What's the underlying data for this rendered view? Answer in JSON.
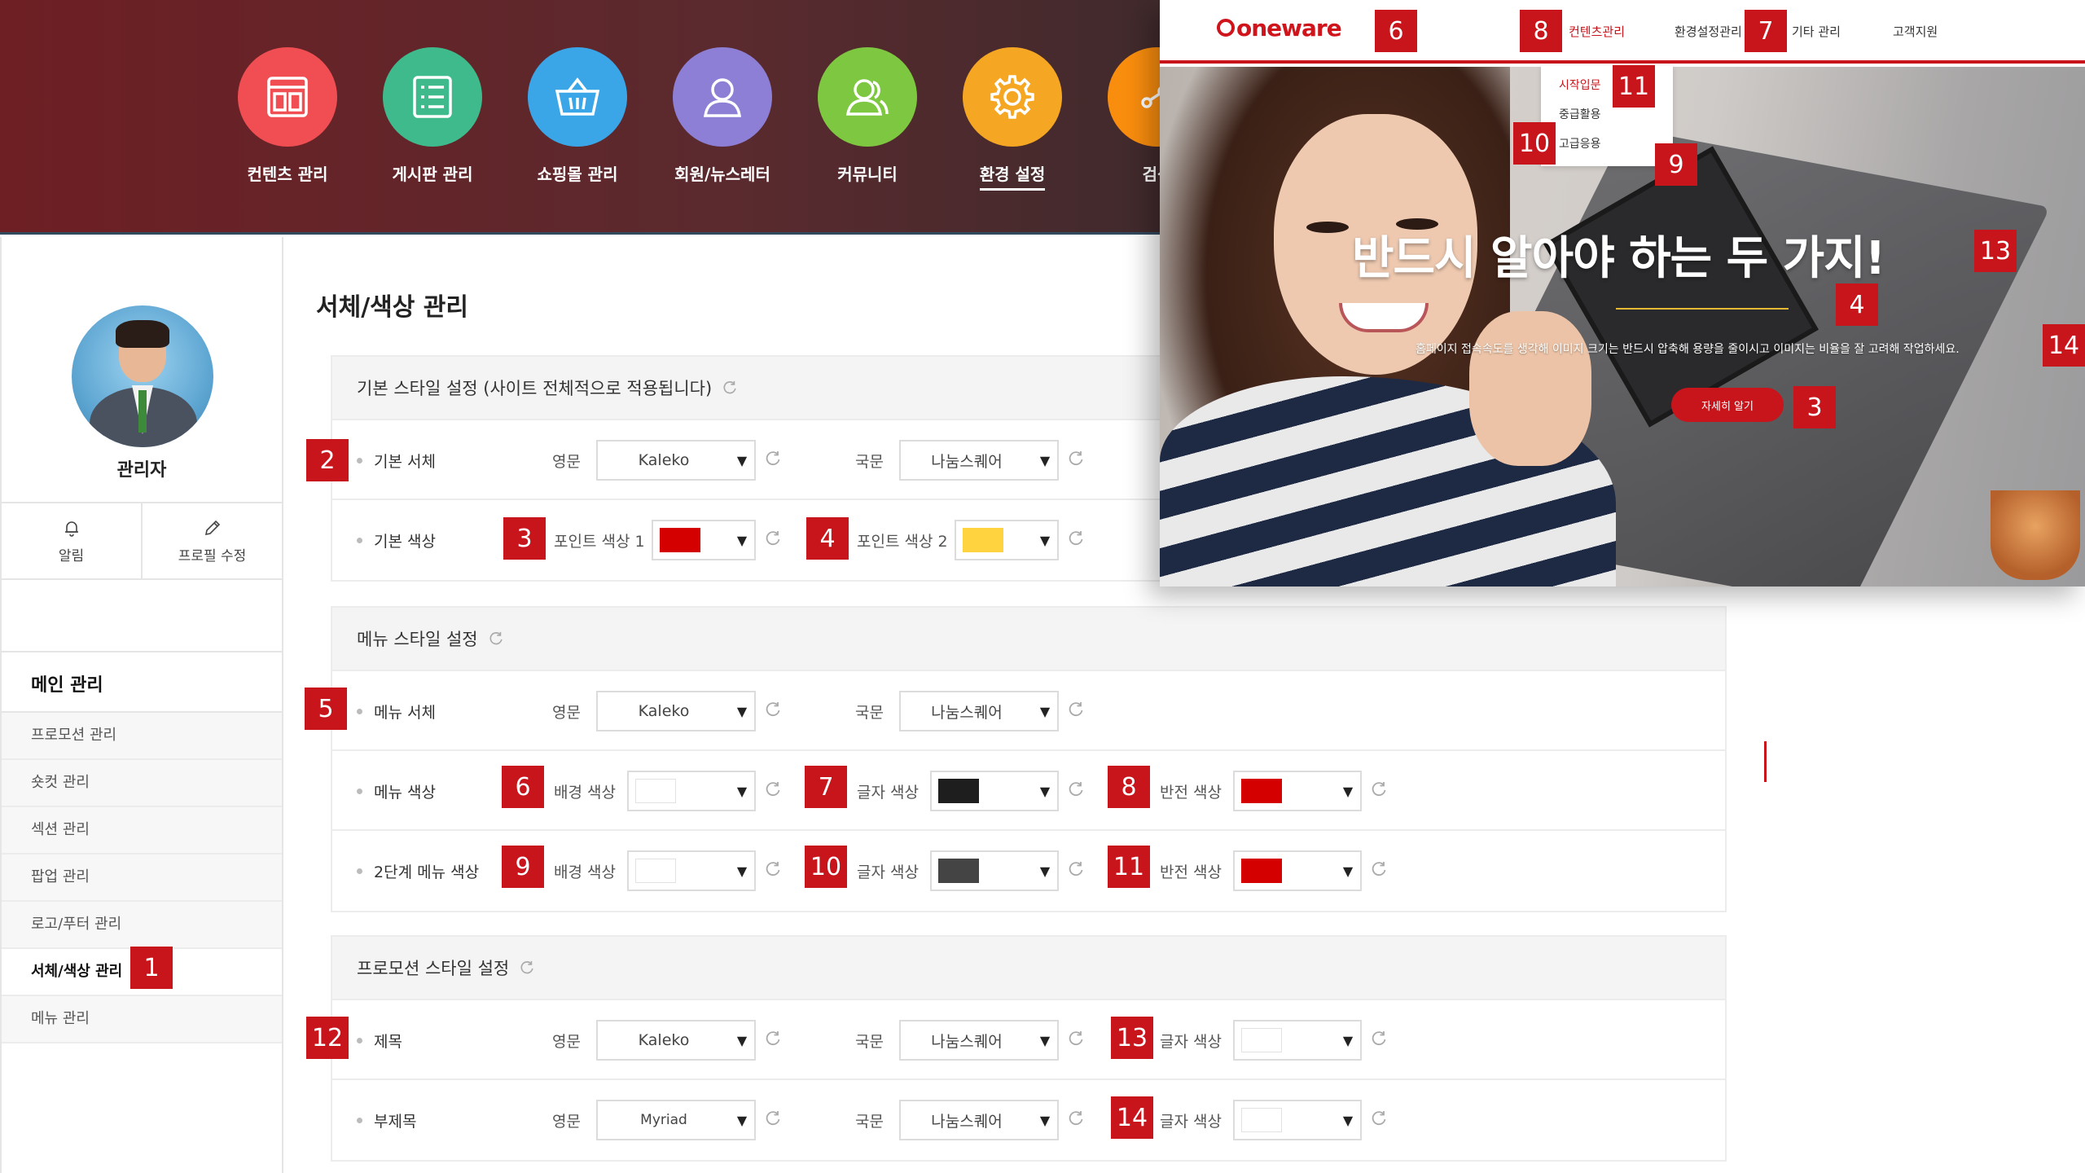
{
  "topnav": {
    "items": [
      {
        "label": "컨텐츠 관리",
        "color": "#f04e52",
        "icon": "content-icon"
      },
      {
        "label": "게시판 관리",
        "color": "#3fba8c",
        "icon": "board-icon"
      },
      {
        "label": "쇼핑몰 관리",
        "color": "#3aa6e8",
        "icon": "basket-icon"
      },
      {
        "label": "회원/뉴스레터",
        "color": "#8d7fd6",
        "icon": "user-icon"
      },
      {
        "label": "커뮤니티",
        "color": "#7ec740",
        "icon": "users-icon"
      },
      {
        "label": "환경 설정",
        "color": "#f5a623",
        "icon": "gear-icon",
        "active": true
      },
      {
        "label": "검색",
        "color": "#f98d0e",
        "icon": "share-icon"
      }
    ]
  },
  "sidebar": {
    "admin_name": "관리자",
    "actions": {
      "notify": "알림",
      "edit_profile": "프로필 수정"
    },
    "menu_title": "메인 관리",
    "menu_items": [
      "프로모션 관리",
      "숏컷 관리",
      "섹션 관리",
      "팝업 관리",
      "로고/푸터 관리",
      "서체/색상 관리",
      "메뉴 관리"
    ],
    "active_index": 5
  },
  "main": {
    "title": "서체/색상 관리",
    "basic": {
      "header": "기본 스타일 설정 (사이트 전체적으로 적용됩니다)",
      "font_row": {
        "label": "기본 서체",
        "en_label": "영문",
        "en_value": "Kaleko",
        "ko_label": "국문",
        "ko_value": "나눔스퀘어"
      },
      "color_row": {
        "label": "기본 색상",
        "p1_label": "포인트 색상 1",
        "p1_color": "#d40000",
        "p2_label": "포인트 색상 2",
        "p2_color": "#ffd23f"
      }
    },
    "menu": {
      "header": "메뉴 스타일 설정",
      "font_row": {
        "label": "메뉴 서체",
        "en_label": "영문",
        "en_value": "Kaleko",
        "ko_label": "국문",
        "ko_value": "나눔스퀘어"
      },
      "color_row": {
        "label": "메뉴 색상",
        "bg_label": "배경 색상",
        "bg_color": "#ffffff",
        "text_label": "글자 색상",
        "text_color": "#1e1e1e",
        "inv_label": "반전 색상",
        "inv_color": "#d40000"
      },
      "sub_row": {
        "label": "2단계 메뉴 색상",
        "bg_label": "배경 색상",
        "bg_color": "#ffffff",
        "text_label": "글자 색상",
        "text_color": "#444444",
        "inv_label": "반전 색상",
        "inv_color": "#d40000"
      }
    },
    "promo": {
      "header": "프로모션 스타일 설정",
      "title_row": {
        "label": "제목",
        "en_label": "영문",
        "en_value": "Kaleko",
        "ko_label": "국문",
        "ko_value": "나눔스퀘어",
        "color_label": "글자 색상",
        "color": "#ffffff"
      },
      "subtitle_row": {
        "label": "부제목",
        "en_label": "영문",
        "en_value": "Myriad",
        "ko_label": "국문",
        "ko_value": "나눔스퀘어",
        "color_label": "글자 색상",
        "color": "#ffffff"
      }
    }
  },
  "badges": {
    "b1": "1",
    "b2": "2",
    "b3": "3",
    "b4": "4",
    "b5": "5",
    "b6": "6",
    "b7": "7",
    "b8": "8",
    "b9": "9",
    "b10": "10",
    "b11": "11",
    "b12": "12",
    "b13": "13",
    "b14": "14"
  },
  "preview": {
    "logo": "oneware",
    "menu": [
      "컨텐츠관리",
      "환경설정관리",
      "기타 관리",
      "고객지원"
    ],
    "dropdown": [
      "시작입문",
      "중급활용",
      "고급응용"
    ],
    "hero_title": "반드시 알아야 하는 두 가지!",
    "hero_sub": "홈페이지 접속속도를 생각해 이미지 크기는 반드시 압축해 용량을 줄이시고 이미지는 비율을 잘 고려해 작업하세요.",
    "hero_button": "자세히 알기"
  }
}
